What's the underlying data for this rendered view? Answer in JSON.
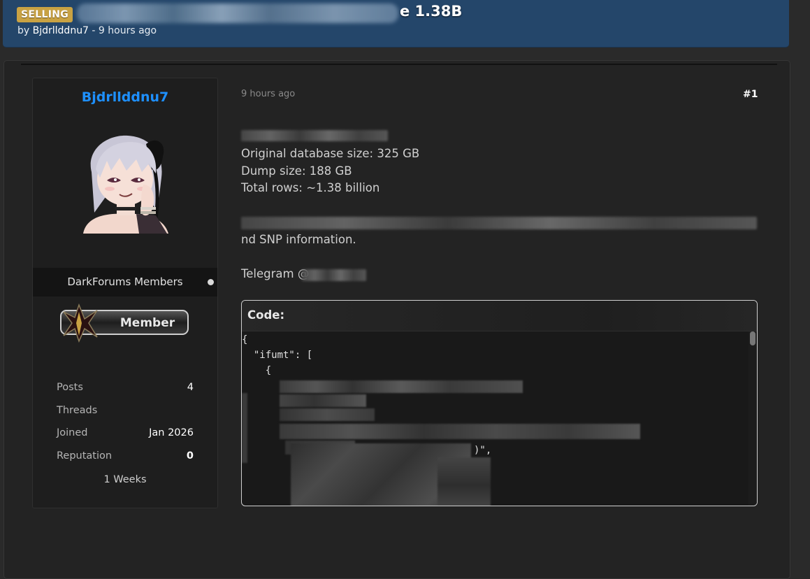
{
  "thread": {
    "prefix": "SELLING",
    "title_suffix": "e 1.38B",
    "by_label": "by",
    "author": "Bjdrllddnu7",
    "time": "9 hours ago"
  },
  "user": {
    "name": "Bjdrllddnu7",
    "group": "DarkForums Members",
    "badge": "Member",
    "stats": [
      {
        "label": "Posts",
        "value": "4"
      },
      {
        "label": "Threads",
        "value": ""
      },
      {
        "label": "Joined",
        "value": "Jan 2026"
      },
      {
        "label": "Reputation",
        "value": "0"
      }
    ],
    "tenure": "1 Weeks"
  },
  "post": {
    "time": "9 hours ago",
    "number": "#1",
    "lines": [
      "Original database size: 325 GB",
      "Dump size: 188 GB",
      "Total rows: ~1.38 billion"
    ],
    "partial_line": "nd SNP information.",
    "telegram_label": "Telegram @"
  },
  "code": {
    "header": "Code:",
    "lines": [
      "{",
      "  \"ifumt\": [",
      "    {"
    ],
    "fragment": ")\","
  }
}
